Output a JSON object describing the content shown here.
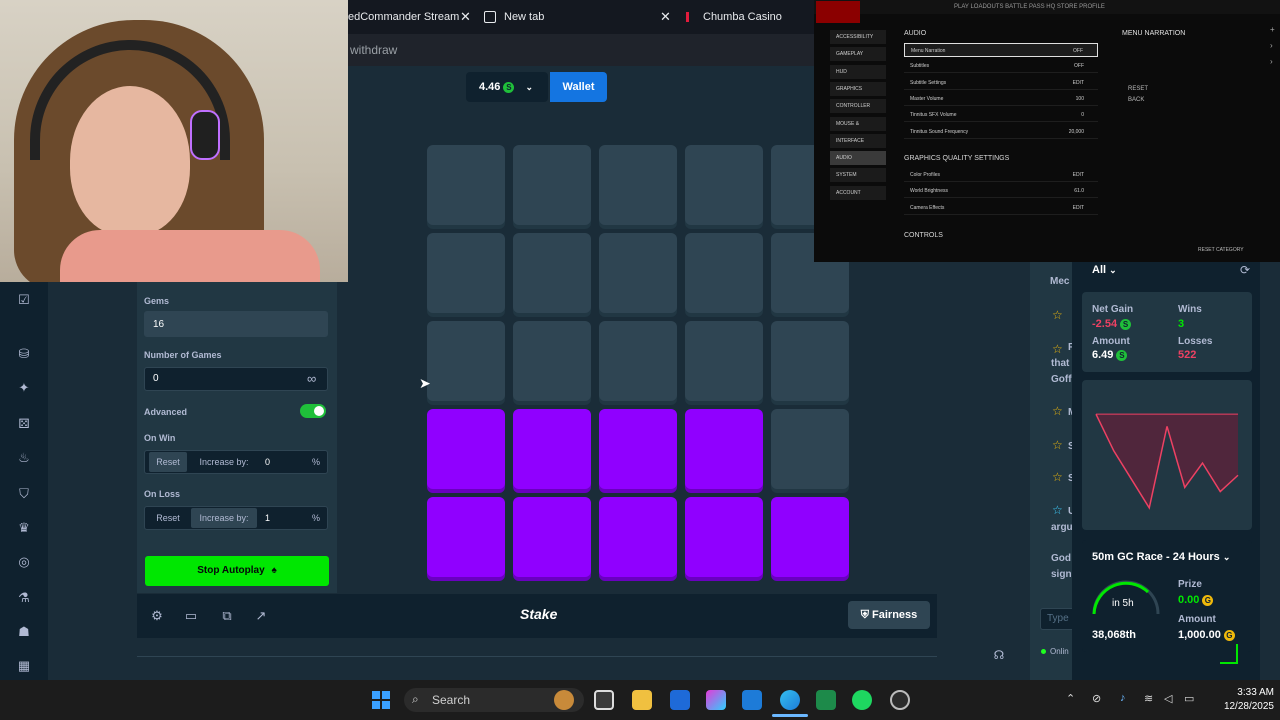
{
  "browser": {
    "tabs": [
      {
        "label": "edCommander Stream -"
      },
      {
        "label": "New tab"
      },
      {
        "label": "Chumba Casino"
      }
    ],
    "url_fragment": "withdraw"
  },
  "header": {
    "balance": "4.46",
    "currency_symbol": "S",
    "wallet_label": "Wallet"
  },
  "config": {
    "gems_label": "Gems",
    "gems_value": "16",
    "num_games_label": "Number of Games",
    "num_games_value": "0",
    "infinity_symbol": "∞",
    "advanced_label": "Advanced",
    "advanced_enabled": true,
    "on_win_label": "On Win",
    "on_loss_label": "On Loss",
    "reset_label": "Reset",
    "increase_by_label": "Increase by:",
    "on_win_value": "0",
    "on_loss_value": "1",
    "percent": "%",
    "stop_autoplay_label": "Stop Autoplay"
  },
  "board": {
    "rows": [
      [
        "hidden",
        "hidden",
        "hidden",
        "hidden",
        "hidden"
      ],
      [
        "hidden",
        "hidden",
        "hidden",
        "hidden",
        "hidden"
      ],
      [
        "hidden",
        "hidden",
        "hidden",
        "hidden",
        "hidden"
      ],
      [
        "gem",
        "gem",
        "gem",
        "gem",
        "hidden"
      ],
      [
        "gem",
        "gem",
        "gem",
        "gem",
        "gem"
      ]
    ],
    "gem_color": "#9000ff"
  },
  "footer": {
    "logo": "Stake",
    "fairness_label": "Fairness"
  },
  "chat": {
    "fragments": [
      "Mec",
      "F",
      "that",
      "Goff",
      "M",
      "S",
      "S",
      "U",
      "argu",
      "God",
      "sign",
      "Type",
      "Onlin"
    ]
  },
  "stats": {
    "filter": "All",
    "net_gain_label": "Net Gain",
    "net_gain_value": "-2.54",
    "wins_label": "Wins",
    "wins_value": "3",
    "amount_label": "Amount",
    "amount_value": "6.49",
    "losses_label": "Losses",
    "losses_value": "522",
    "loss_color": "#ed4163",
    "win_color": "#00e701",
    "chart_data": {
      "type": "line",
      "x": [
        0,
        1,
        2,
        3,
        4,
        5,
        6,
        7,
        8
      ],
      "y": [
        0,
        -0.9,
        -1.6,
        -2.3,
        -0.3,
        -1.8,
        -1.2,
        -1.9,
        -1.5
      ],
      "ylim": [
        -2.5,
        0.2
      ]
    },
    "race_title": "50m GC Race - 24 Hours",
    "race_time": "in 5h",
    "race_rank": "38,068th",
    "prize_label": "Prize",
    "prize_value": "0.00",
    "race_amount_label": "Amount",
    "race_amount_value": "1,000.00",
    "coin_letter_s": "S",
    "coin_letter_g": "G"
  },
  "game_settings": {
    "top_menu": "PLAY  LOADOUTS  BATTLE PASS  HQ  STORE  PROFILE",
    "categories": [
      "ACCESSIBILITY",
      "GAMEPLAY",
      "HUD",
      "GRAPHICS",
      "CONTROLLER",
      "MOUSE & KEYBOARD",
      "INTERFACE",
      "AUDIO",
      "SYSTEM",
      "ACCOUNT"
    ],
    "active_category": 7,
    "audio_header": "AUDIO",
    "audio_rows": [
      {
        "label": "Menu Narration",
        "value": "OFF"
      },
      {
        "label": "Subtitles",
        "value": "OFF"
      },
      {
        "label": "Subtitle Settings",
        "value": "EDIT"
      },
      {
        "label": "Master Volume",
        "value": "100"
      },
      {
        "label": "Tinnitus SFX Volume",
        "value": "0"
      },
      {
        "label": "Tinnitus Sound Frequency",
        "value": "20,000"
      }
    ],
    "graphics_header": "GRAPHICS QUALITY SETTINGS",
    "graphics_rows": [
      {
        "label": "Color Profiles",
        "value": "EDIT"
      },
      {
        "label": "World Brightness",
        "value": "61.0"
      },
      {
        "label": "Camera Effects",
        "value": "EDIT"
      }
    ],
    "controls_header": "CONTROLS",
    "desc_title": "MENU NARRATION",
    "desc_reset": "RESET",
    "desc_back": "BACK",
    "reset_category": "RESET CATEGORY"
  },
  "taskbar": {
    "search_placeholder": "Search",
    "time": "3:33 AM",
    "date": "12/28/2025"
  }
}
